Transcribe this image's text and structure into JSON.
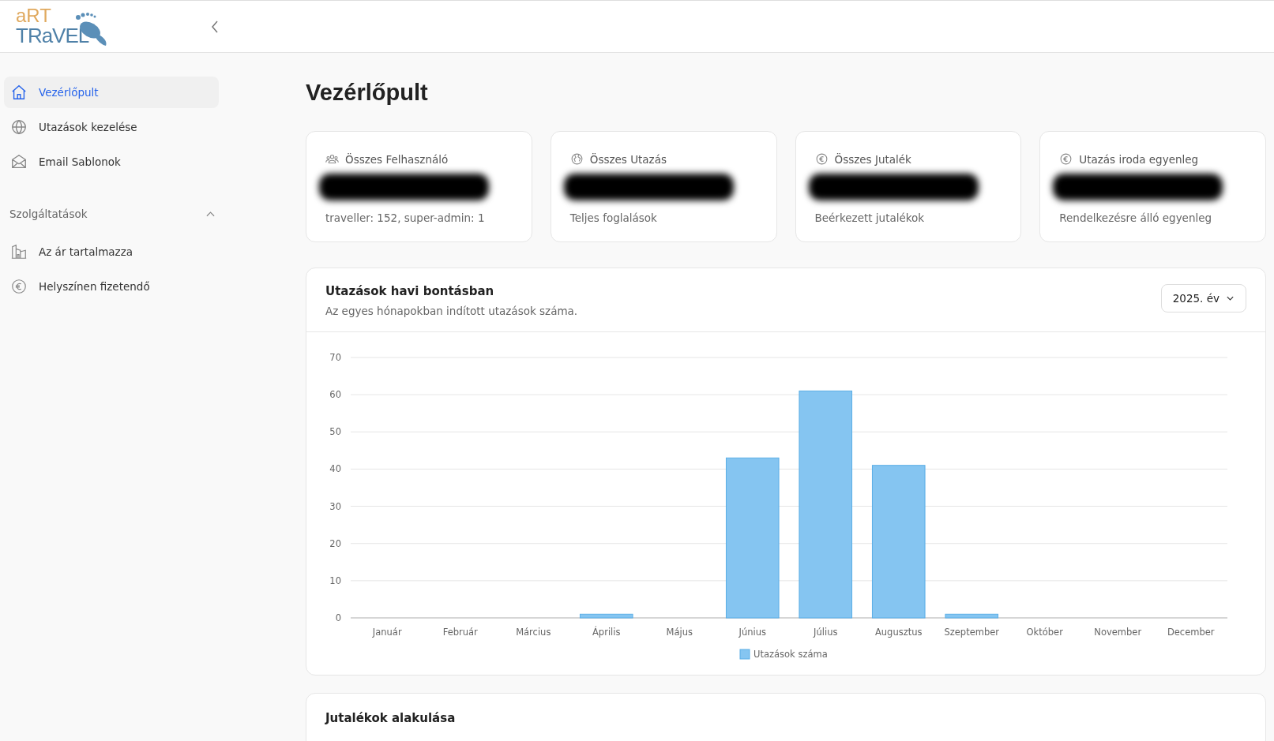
{
  "logo": {
    "line1": "aRT",
    "line2": "TRaVEL"
  },
  "sidebar": {
    "items": [
      {
        "label": "Vezérlőpult",
        "kind": "home",
        "selected": true
      },
      {
        "label": "Utazások kezelése",
        "kind": "globe",
        "selected": false
      },
      {
        "label": "Email Sablonok",
        "kind": "mail",
        "selected": false
      }
    ],
    "section": {
      "title": "Szolgáltatások",
      "expanded": true,
      "items": [
        {
          "label": "Az ár tartalmazza",
          "kind": "building",
          "selected": false
        },
        {
          "label": "Helyszínen fizetendő",
          "kind": "euro",
          "selected": false
        }
      ]
    }
  },
  "page_title": "Vezérlőpult",
  "stats": [
    {
      "title": "Összes Felhasználó",
      "kind": "users",
      "subtitle": "traveller: 152, super-admin: 1"
    },
    {
      "title": "Összes Utazás",
      "kind": "globe",
      "subtitle": "Teljes foglalások"
    },
    {
      "title": "Összes Jutalék",
      "kind": "euro",
      "subtitle": "Beérkezett jutalékok"
    },
    {
      "title": "Utazás iroda egyenleg",
      "kind": "euro",
      "subtitle": "Rendelkezésre álló egyenleg"
    }
  ],
  "monthly_card": {
    "title": "Utazások havi bontásban",
    "subtitle": "Az egyes hónapokban indított utazások száma.",
    "year_select": "2025. év",
    "chart_data": {
      "type": "bar",
      "categories": [
        "Január",
        "Február",
        "Március",
        "Április",
        "Május",
        "Június",
        "Július",
        "Augusztus",
        "Szeptember",
        "Október",
        "November",
        "December"
      ],
      "series": [
        {
          "name": "Utazások száma",
          "color": "#85c5f1",
          "values": [
            0,
            0,
            0,
            1,
            0,
            43,
            61,
            41,
            1,
            0,
            0,
            0
          ]
        }
      ],
      "ylim": [
        0,
        70
      ],
      "grid": true,
      "yticks": [
        0,
        10,
        20,
        30,
        40,
        50,
        60,
        70
      ]
    }
  },
  "commission_card": {
    "title": "Jutalékok alakulása"
  }
}
